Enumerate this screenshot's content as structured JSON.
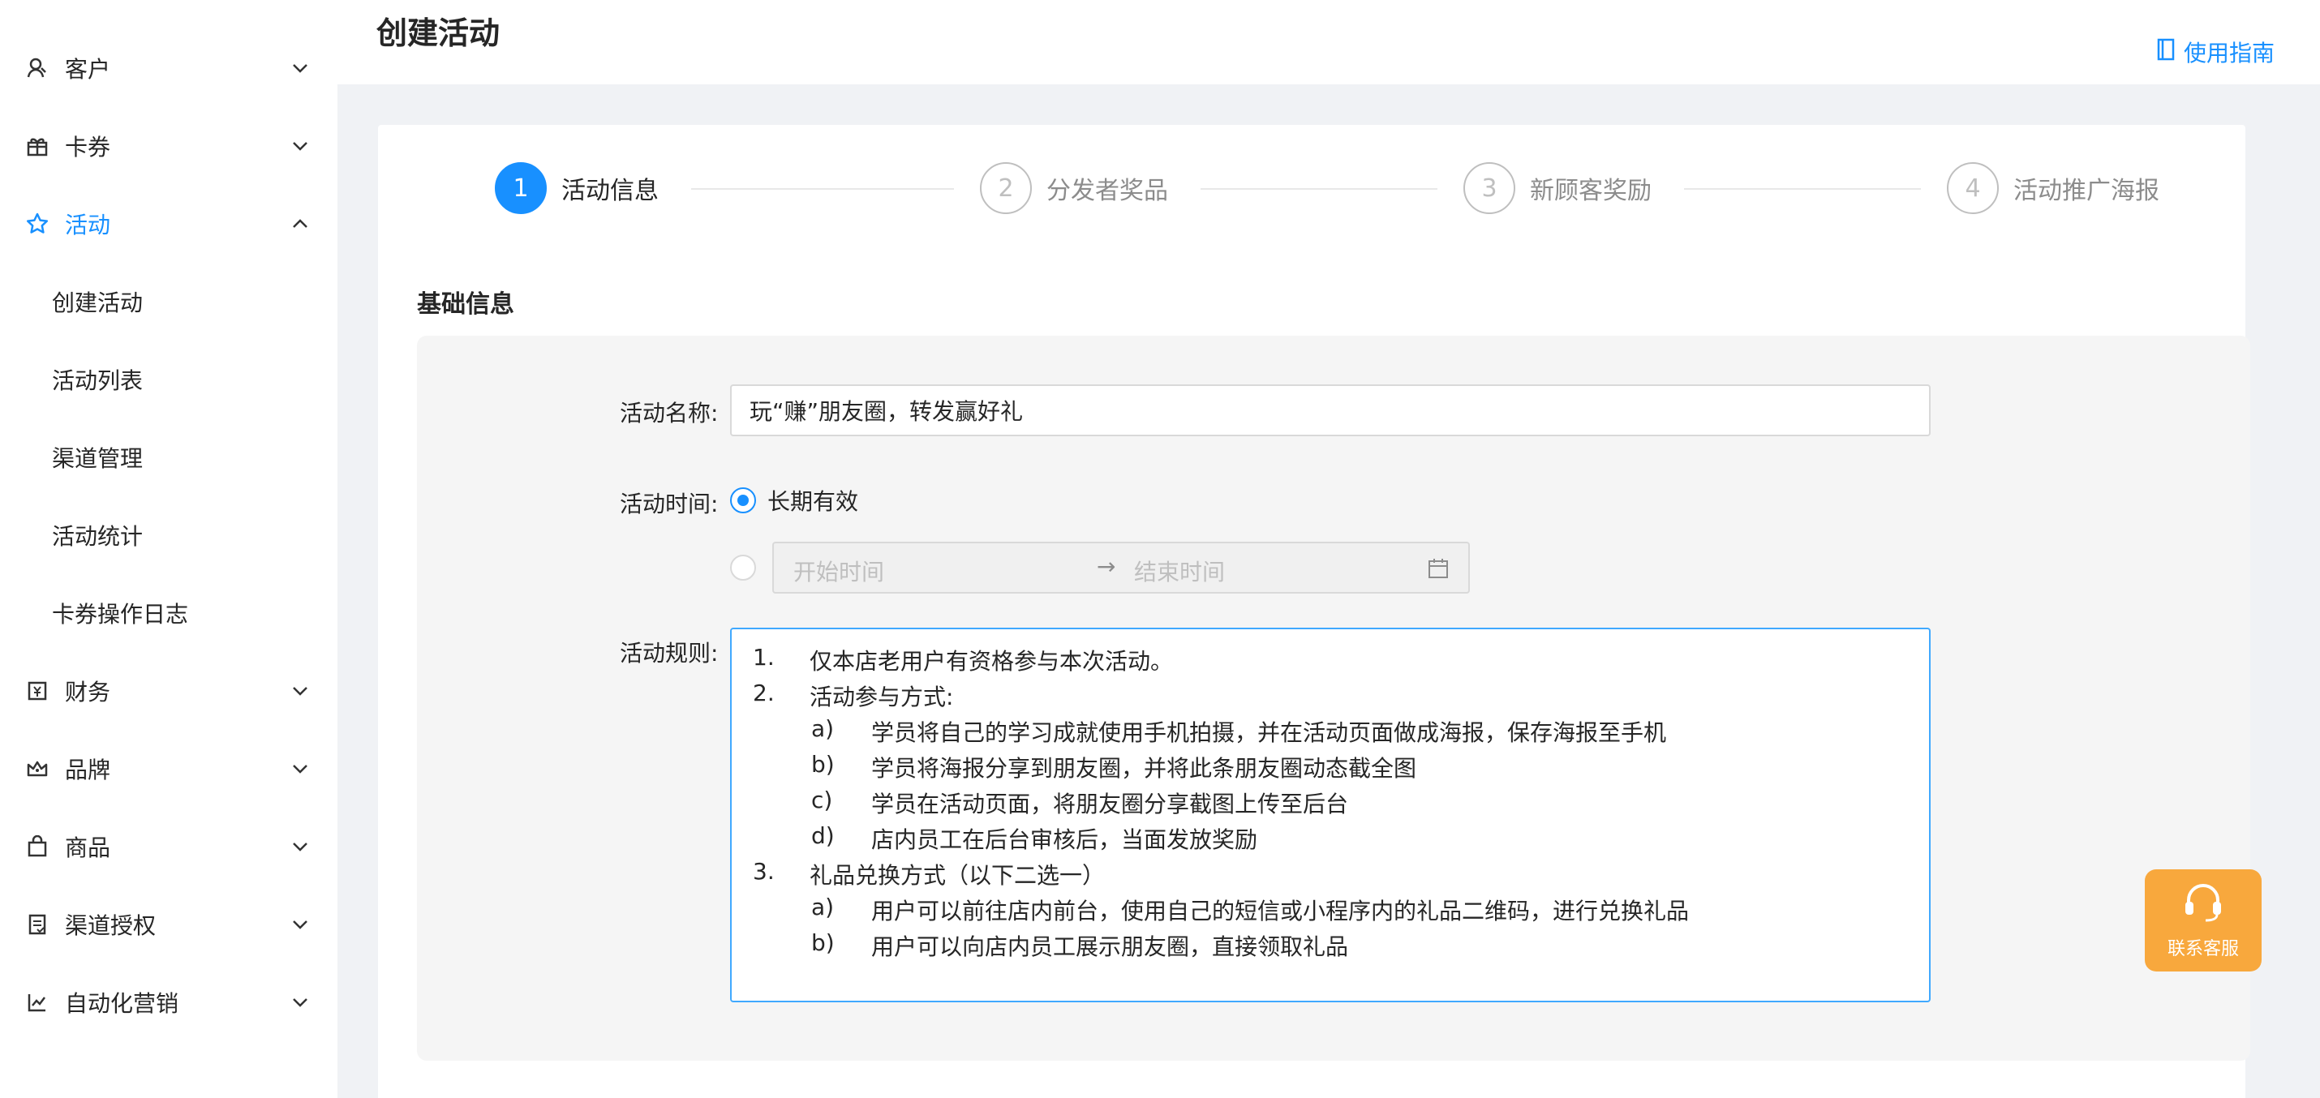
{
  "sidebar": {
    "items": [
      {
        "label": "客户",
        "icon": "user-icon"
      },
      {
        "label": "卡券",
        "icon": "gift-icon"
      },
      {
        "label": "活动",
        "icon": "star-icon",
        "active": true
      },
      {
        "label": "财务",
        "icon": "wallet-icon"
      },
      {
        "label": "品牌",
        "icon": "crown-icon"
      },
      {
        "label": "商品",
        "icon": "shopping-bag-icon"
      },
      {
        "label": "渠道授权",
        "icon": "document-icon"
      },
      {
        "label": "自动化营销",
        "icon": "line-chart-icon"
      }
    ],
    "sub_items": [
      "创建活动",
      "活动列表",
      "渠道管理",
      "活动统计",
      "卡券操作日志"
    ]
  },
  "header": {
    "title": "创建活动",
    "guide_link": "使用指南"
  },
  "steps": [
    {
      "number": "1",
      "label": "活动信息",
      "active": true
    },
    {
      "number": "2",
      "label": "分发者奖品",
      "active": false
    },
    {
      "number": "3",
      "label": "新顾客奖励",
      "active": false
    },
    {
      "number": "4",
      "label": "活动推广海报",
      "active": false
    }
  ],
  "section_title": "基础信息",
  "form": {
    "name_label": "活动名称:",
    "name_value": "玩“赚”朋友圈，转发赢好礼",
    "time_label": "活动时间:",
    "time_option_long": "长期有效",
    "range_start_placeholder": "开始时间",
    "range_arrow": "→",
    "range_end_placeholder": "结束时间",
    "rules_label": "活动规则:",
    "rules": [
      {
        "num": "1.",
        "text": "仅本店老用户有资格参与本次活动。",
        "level": 1
      },
      {
        "num": "2.",
        "text": "活动参与方式:",
        "level": 1
      },
      {
        "num": "a)",
        "text": "学员将自己的学习成就使用手机拍摄，并在活动页面做成海报，保存海报至手机",
        "level": 2
      },
      {
        "num": "b)",
        "text": "学员将海报分享到朋友圈，并将此条朋友圈动态截全图",
        "level": 2
      },
      {
        "num": "c)",
        "text": "学员在活动页面，将朋友圈分享截图上传至后台",
        "level": 2
      },
      {
        "num": "d)",
        "text": "店内员工在后台审核后，当面发放奖励",
        "level": 2
      },
      {
        "num": "3.",
        "text": "礼品兑换方式（以下二选一）",
        "level": 1
      },
      {
        "num": "a)",
        "text": "用户可以前往店内前台，使用自己的短信或小程序内的礼品二维码，进行兑换礼品",
        "level": 2
      },
      {
        "num": "b)",
        "text": "用户可以向店内员工展示朋友圈，直接领取礼品",
        "level": 2
      }
    ]
  },
  "support": {
    "label": "联系客服"
  },
  "colors": {
    "accent": "#1890ff",
    "support_bg": "#f8a83d"
  }
}
